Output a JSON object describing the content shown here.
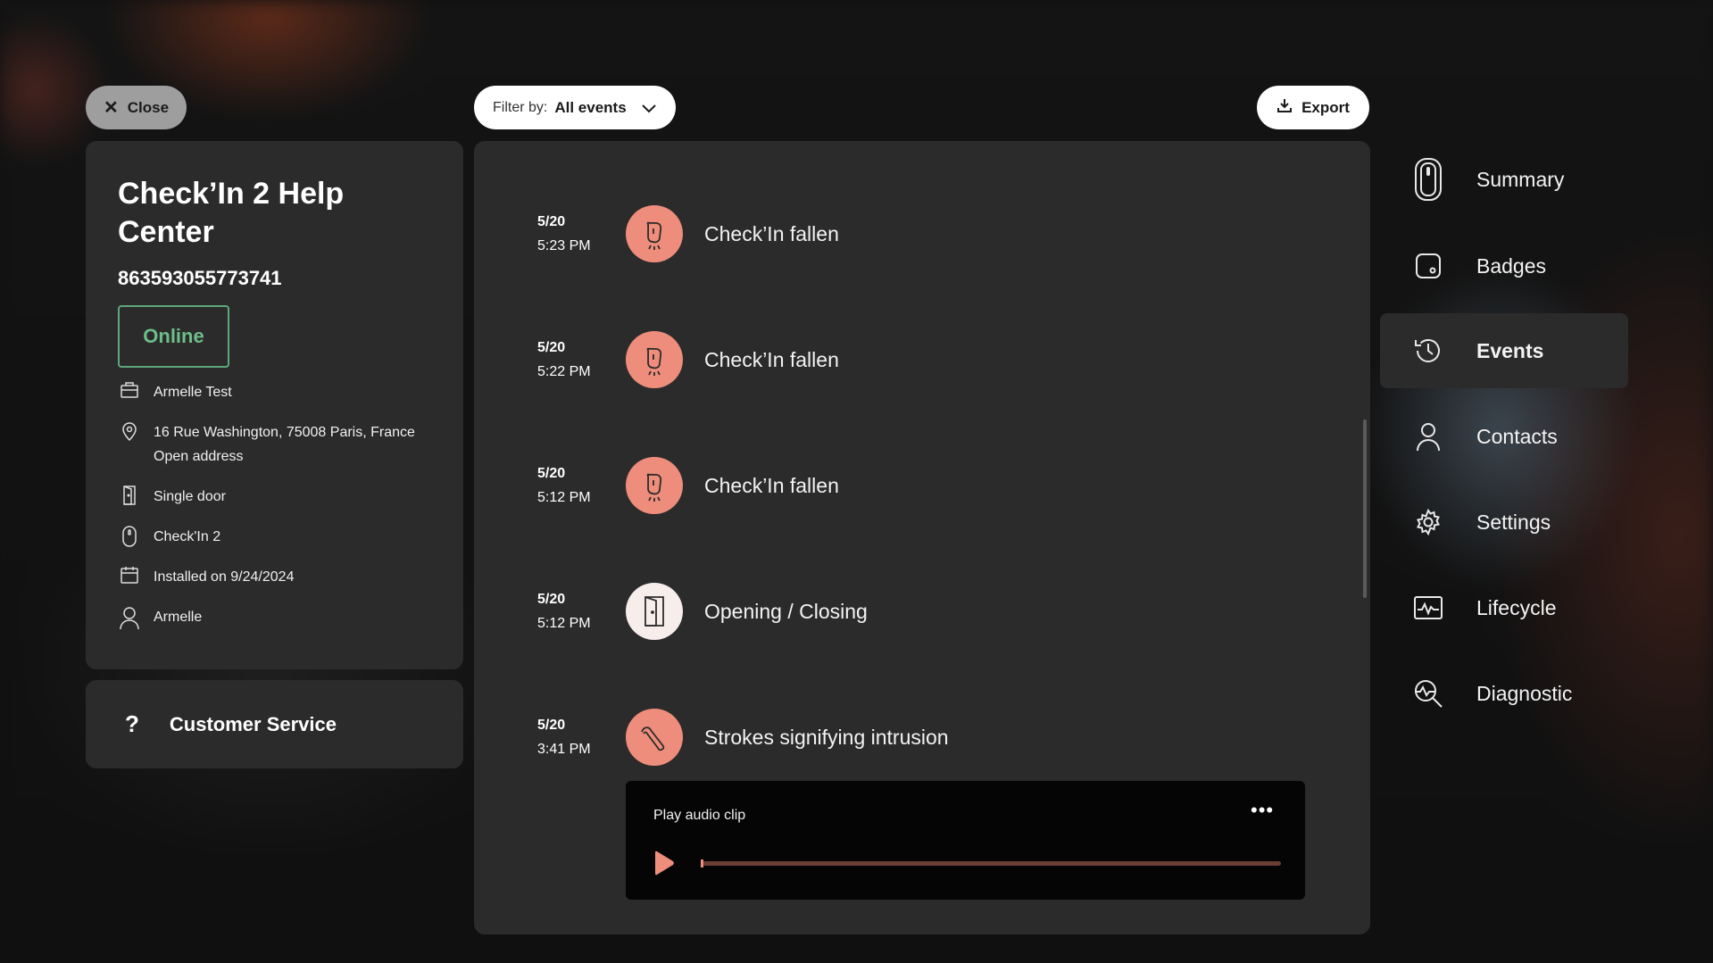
{
  "close_button": {
    "label": "Close"
  },
  "device": {
    "title": "Check’In 2 Help Center",
    "serial": "863593055773741",
    "status": "Online",
    "status_color": "#6dbd8a",
    "info": [
      {
        "icon": "building-icon",
        "text": "Armelle Test"
      },
      {
        "icon": "location-pin-icon",
        "text": "16 Rue Washington, 75008 Paris, France",
        "text2": "Open address"
      },
      {
        "icon": "door-icon",
        "text": "Single door"
      },
      {
        "icon": "device-icon",
        "text": "Check'In 2"
      },
      {
        "icon": "calendar-icon",
        "text": "Installed on 9/24/2024"
      },
      {
        "icon": "user-icon",
        "text": "Armelle"
      }
    ]
  },
  "customer_service": {
    "icon": "question-icon",
    "glyph": "?",
    "label": "Customer Service"
  },
  "filter": {
    "label": "Filter by:",
    "value": "All events"
  },
  "export": {
    "label": "Export"
  },
  "events": [
    {
      "date": "5/20",
      "time": "5:23 PM",
      "icon": "fallen-device-icon",
      "name": "Check’In fallen"
    },
    {
      "date": "5/20",
      "time": "5:22 PM",
      "icon": "fallen-device-icon",
      "name": "Check’In fallen"
    },
    {
      "date": "5/20",
      "time": "5:12 PM",
      "icon": "fallen-device-icon",
      "name": "Check’In fallen"
    },
    {
      "date": "5/20",
      "time": "5:12 PM",
      "icon": "door-icon",
      "name": "Opening / Closing"
    },
    {
      "date": "5/20",
      "time": "3:41 PM",
      "icon": "crowbar-icon",
      "name": "Strokes signifying intrusion"
    }
  ],
  "audio": {
    "title": "Play audio clip",
    "more": "•••",
    "progress": 0
  },
  "nav": [
    {
      "label": "Summary",
      "icon": "device-icon",
      "active": false
    },
    {
      "label": "Badges",
      "icon": "badge-icon",
      "active": false
    },
    {
      "label": "Events",
      "icon": "history-icon",
      "active": true
    },
    {
      "label": "Contacts",
      "icon": "user-icon",
      "active": false
    },
    {
      "label": "Settings",
      "icon": "gear-icon",
      "active": false
    },
    {
      "label": "Lifecycle",
      "icon": "activity-icon",
      "active": false
    },
    {
      "label": "Diagnostic",
      "icon": "diagnostic-icon",
      "active": false
    }
  ],
  "colors": {
    "accent": "#ee8d7b",
    "panel": "#2b2b2b",
    "online": "#5fa77a"
  }
}
